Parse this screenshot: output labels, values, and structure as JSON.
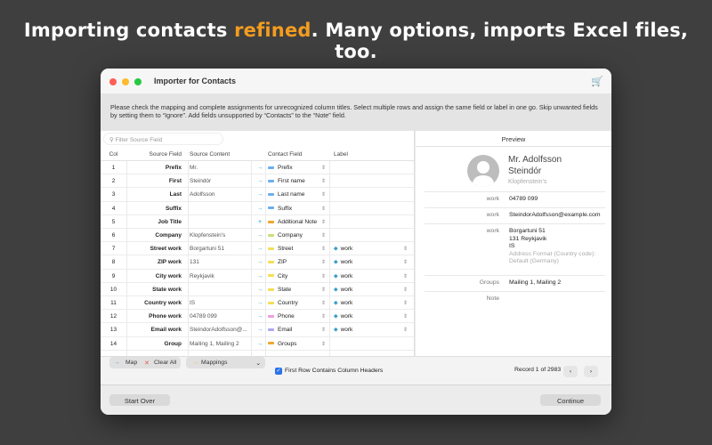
{
  "headline": {
    "pre": "Importing contacts ",
    "accent": "refined",
    "post": ". Many options, imports Excel files, too."
  },
  "window": {
    "title": "Importer for Contacts",
    "cart_icon": "cart-icon"
  },
  "instructions": "Please check the mapping and complete assignments for unrecognized column titles. Select multiple rows and assign the same field or label in one go. Skip unwanted fields by setting them to “Ignore”. Add fields unsupported by “Contacts” to the “Note” field.",
  "filter_placeholder": "Filter Source Field",
  "columns": {
    "col": "Col",
    "source_field": "Source Field",
    "source_content": "Source Content",
    "contact_field": "Contact Field",
    "label": "Label"
  },
  "rows": [
    {
      "col": "1",
      "field": "Prefix",
      "content": "Mr.",
      "op": "→",
      "contact": "Prefix",
      "color": "#6aaef0",
      "label": ""
    },
    {
      "col": "2",
      "field": "First",
      "content": "Steindór",
      "op": "→",
      "contact": "First name",
      "color": "#6aaef0",
      "label": ""
    },
    {
      "col": "3",
      "field": "Last",
      "content": "Adolfsson",
      "op": "→",
      "contact": "Last name",
      "color": "#6aaef0",
      "label": ""
    },
    {
      "col": "4",
      "field": "Suffix",
      "content": "",
      "op": "→",
      "contact": "Suffix",
      "color": "#6aaef0",
      "label": ""
    },
    {
      "col": "5",
      "field": "Job Title",
      "content": "",
      "op": "+",
      "contact": "Additional Note",
      "color": "#f2a531",
      "label": ""
    },
    {
      "col": "6",
      "field": "Company",
      "content": "Klopfenstein's",
      "op": "→",
      "contact": "Company",
      "color": "#c8e07a",
      "label": ""
    },
    {
      "col": "7",
      "field": "Street work",
      "content": "Borgartuni 51",
      "op": "→",
      "contact": "Street",
      "color": "#f4de57",
      "label": "work"
    },
    {
      "col": "8",
      "field": "ZIP work",
      "content": "131",
      "op": "→",
      "contact": "ZIP",
      "color": "#f4de57",
      "label": "work"
    },
    {
      "col": "9",
      "field": "City work",
      "content": "Reykjavik",
      "op": "→",
      "contact": "City",
      "color": "#f4de57",
      "label": "work"
    },
    {
      "col": "10",
      "field": "State work",
      "content": "",
      "op": "→",
      "contact": "State",
      "color": "#f4de57",
      "label": "work"
    },
    {
      "col": "11",
      "field": "Country work",
      "content": "IS",
      "op": "→",
      "contact": "Country",
      "color": "#f4de57",
      "label": "work"
    },
    {
      "col": "12",
      "field": "Phone work",
      "content": "04789 099",
      "op": "→",
      "contact": "Phone",
      "color": "#ef9ee0",
      "label": "work"
    },
    {
      "col": "13",
      "field": "Email work",
      "content": "SteindorAdolfsson@...",
      "op": "→",
      "contact": "Email",
      "color": "#a9a9f2",
      "label": "work"
    },
    {
      "col": "14",
      "field": "Group",
      "content": "Mailing 1, Mailing 2",
      "op": "→",
      "contact": "Groups",
      "color": "#f2a531",
      "label": ""
    }
  ],
  "preview": {
    "title": "Preview",
    "name1": "Mr. Adolfsson",
    "name2": "Steindór",
    "company": "Klopfenstein's",
    "fields": [
      {
        "key": "work",
        "lines": [
          "04789 099"
        ]
      },
      {
        "key": "work",
        "lines": [
          "SteindorAdolfsson@example.com"
        ]
      },
      {
        "key": "work",
        "lines": [
          "Borgartuni 51",
          "131 Reykjavik",
          "IS"
        ],
        "note": [
          "Address Format (Country code):",
          "Default (Germany)"
        ]
      },
      {
        "key": "Groups",
        "lines": [
          "Mailing 1, Mailing 2"
        ]
      },
      {
        "key": "Note",
        "lines": []
      }
    ]
  },
  "toolbar": {
    "map": "Map",
    "clear_all": "Clear All",
    "mappings": "Mappings",
    "first_row_checkbox": "First Row Contains Column Headers",
    "first_row_checked": true,
    "record": "Record 1 of 2983"
  },
  "footer": {
    "start_over": "Start Over",
    "continue": "Continue"
  }
}
